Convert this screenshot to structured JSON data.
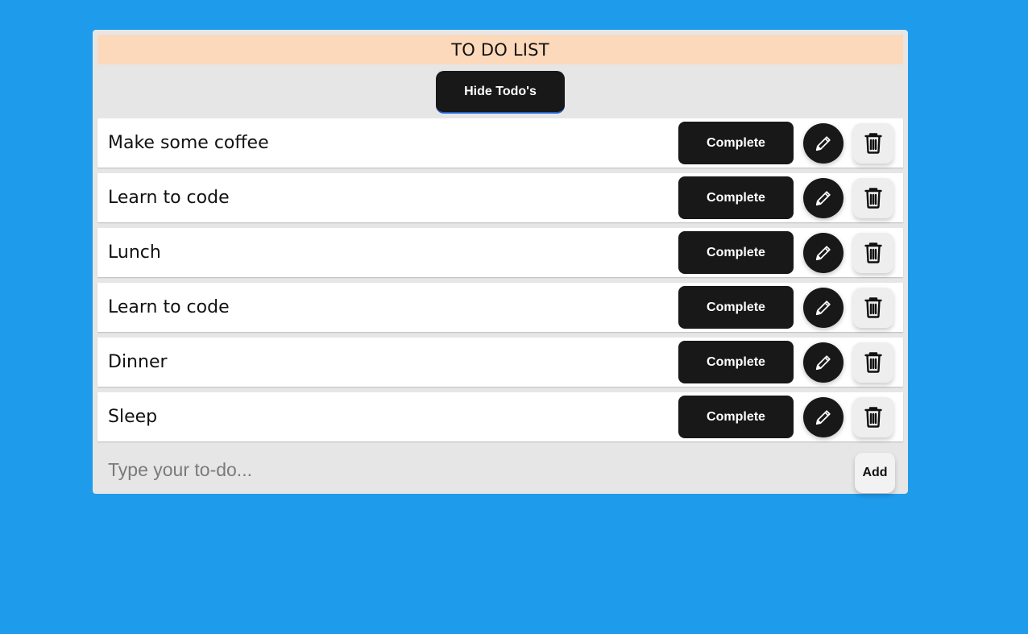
{
  "header": {
    "title": "TO DO LIST"
  },
  "toggle": {
    "label": "Hide Todo's"
  },
  "todos": [
    {
      "text": "Make some coffee",
      "complete_label": "Complete",
      "edit_icon": "pencil-icon",
      "delete_icon": "trash-icon"
    },
    {
      "text": "Learn to code",
      "complete_label": "Complete",
      "edit_icon": "pencil-icon",
      "delete_icon": "trash-icon"
    },
    {
      "text": "Lunch",
      "complete_label": "Complete",
      "edit_icon": "pencil-icon",
      "delete_icon": "trash-icon"
    },
    {
      "text": "Learn to code",
      "complete_label": "Complete",
      "edit_icon": "pencil-icon",
      "delete_icon": "trash-icon"
    },
    {
      "text": "Dinner",
      "complete_label": "Complete",
      "edit_icon": "pencil-icon",
      "delete_icon": "trash-icon"
    },
    {
      "text": "Sleep",
      "complete_label": "Complete",
      "edit_icon": "pencil-icon",
      "delete_icon": "trash-icon"
    }
  ],
  "input": {
    "placeholder": "Type your to-do...",
    "value": ""
  },
  "add": {
    "label": "Add"
  },
  "colors": {
    "background": "#1f9bec",
    "panel": "#e6e6e6",
    "header": "#fdd9bb",
    "button_dark": "#181818",
    "item": "#ffffff"
  }
}
